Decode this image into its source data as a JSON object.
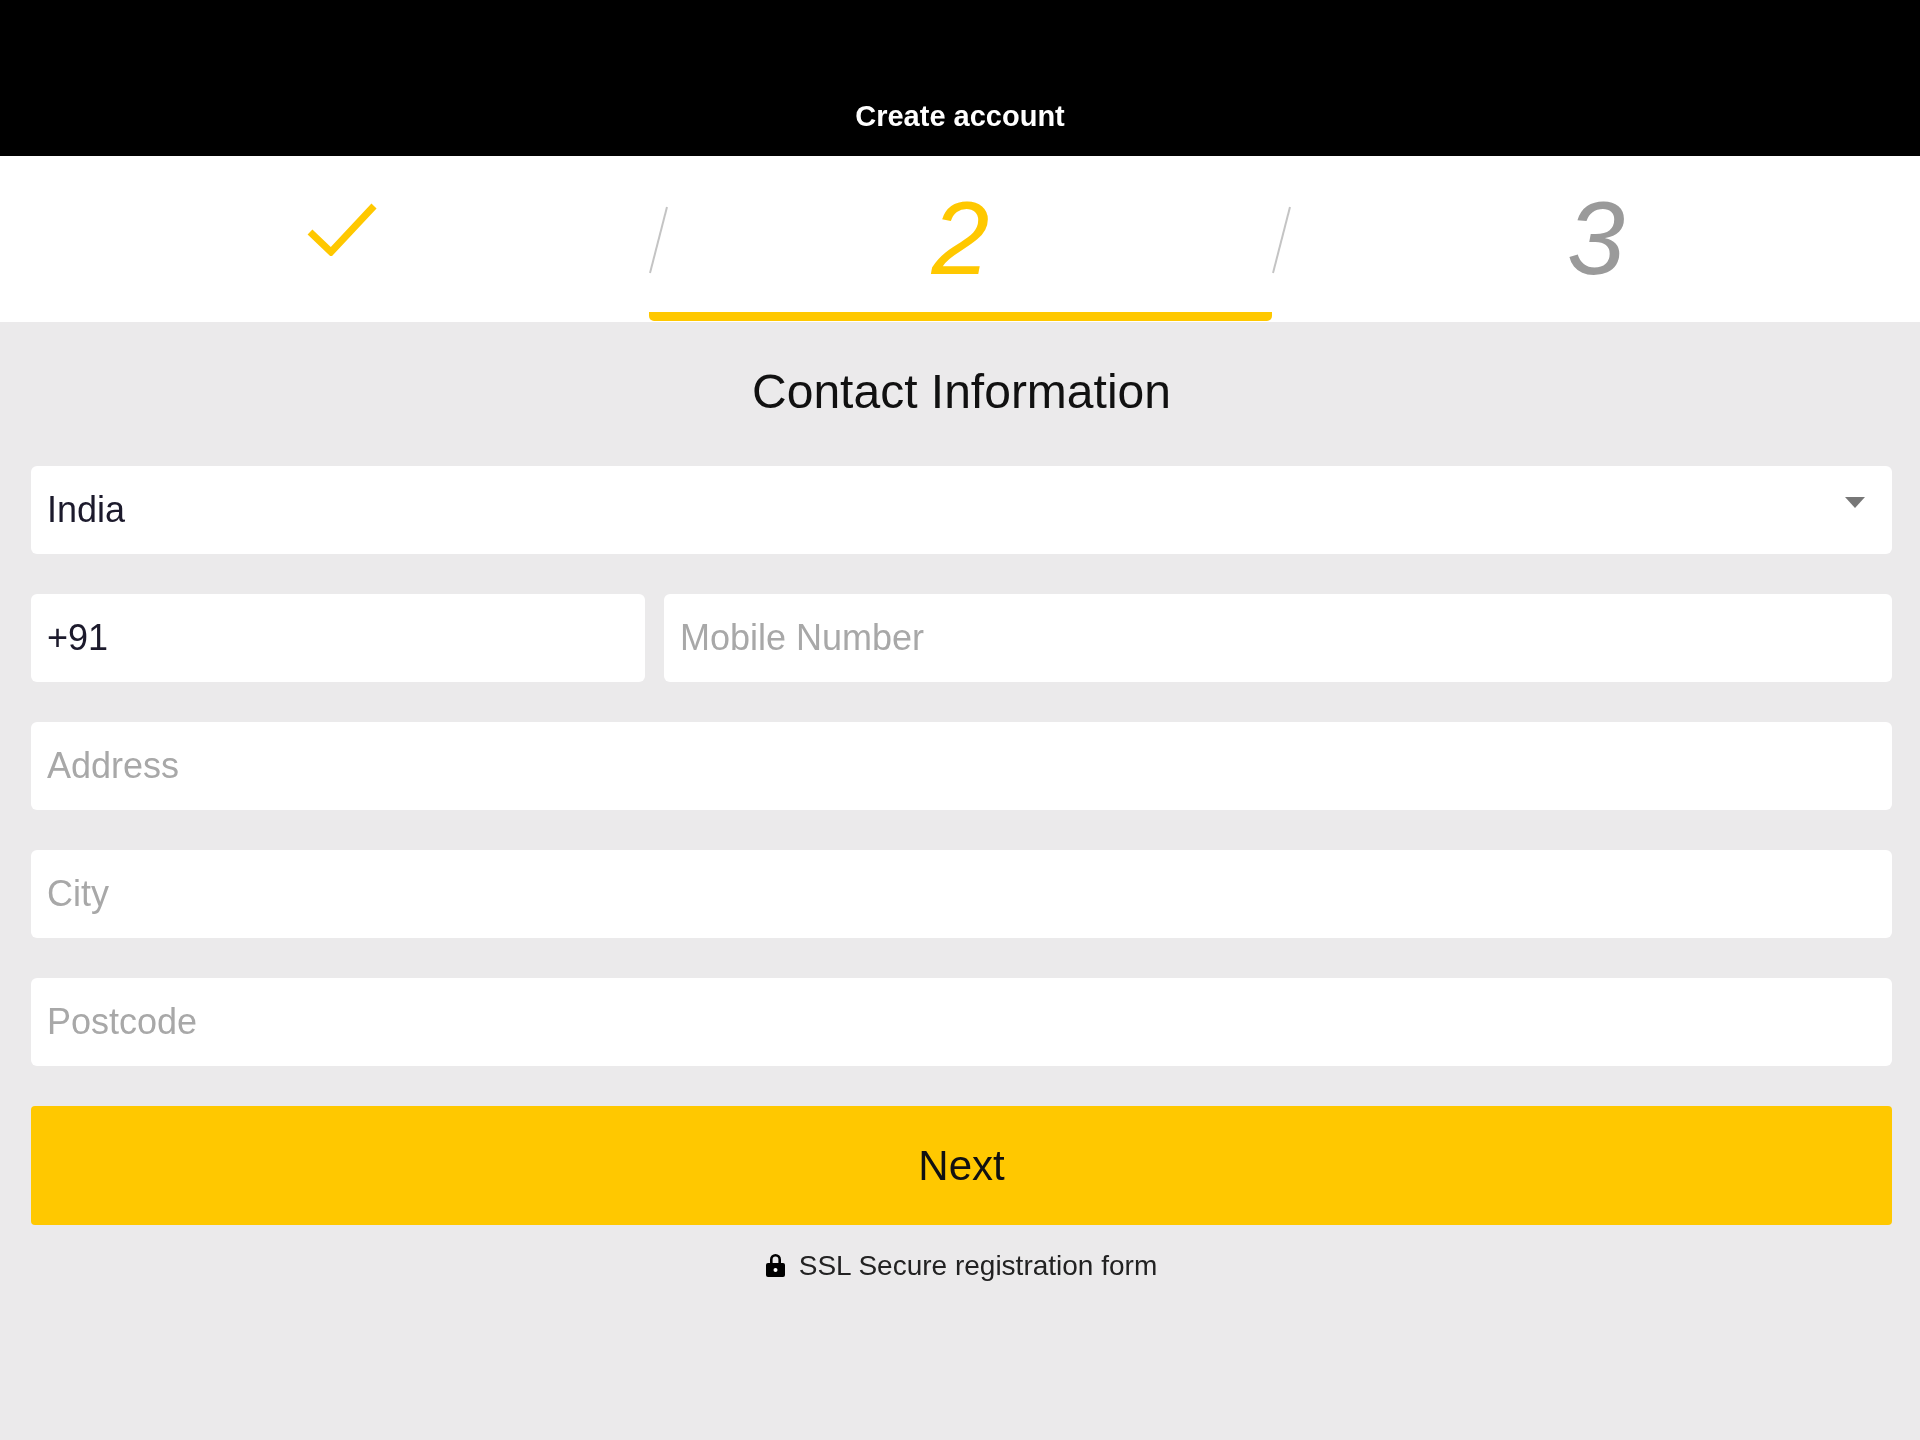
{
  "header": {
    "title": "Create account"
  },
  "steps": [
    {
      "kind": "done",
      "selected": false
    },
    {
      "kind": "number",
      "label": "2",
      "selected": true
    },
    {
      "kind": "number",
      "label": "3",
      "selected": false
    }
  ],
  "form": {
    "title": "Contact Information",
    "country": {
      "value": "India"
    },
    "phone": {
      "prefix": "+91",
      "placeholder": "Mobile Number"
    },
    "fields": [
      {
        "placeholder": "Address"
      },
      {
        "placeholder": "City"
      },
      {
        "placeholder": "Postcode"
      }
    ],
    "submit": "Next",
    "secure_note": "SSL Secure registration form"
  }
}
